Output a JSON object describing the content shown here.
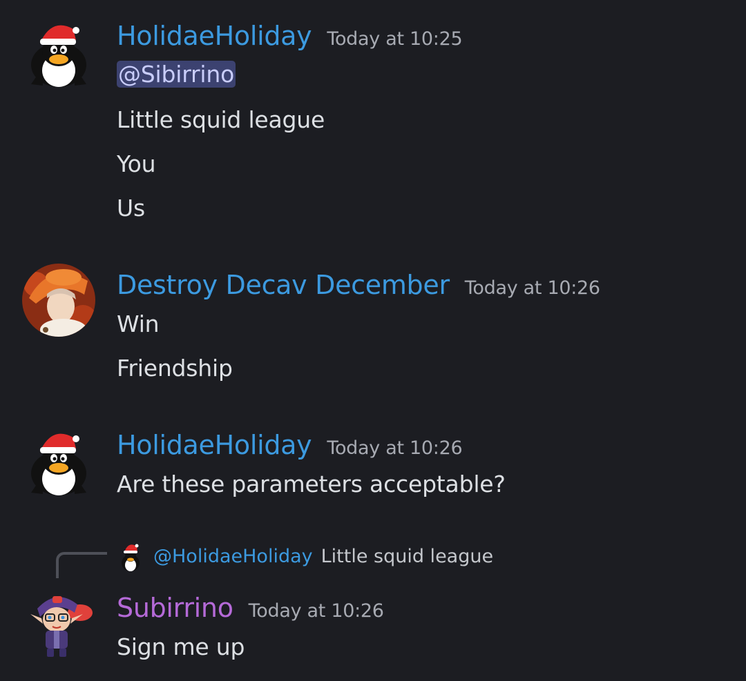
{
  "colors": {
    "background": "#1c1d22",
    "username_blue": "#3c9ae0",
    "username_purple": "#b56ad8",
    "timestamp": "#a7aab2",
    "mention_bg": "#3c4270"
  },
  "messages": [
    {
      "author": "HolidaeHoliday",
      "timestamp": "Today at 10:25",
      "avatar_icon": "santa-penguin-avatar",
      "mention": "@Sibirrino",
      "lines": [
        "Little squid league",
        "You",
        "Us"
      ]
    },
    {
      "author": "Destroy Decav December",
      "timestamp": "Today at 10:26",
      "avatar_icon": "anime-character-avatar",
      "lines": [
        "Win",
        "Friendship"
      ]
    },
    {
      "author": "HolidaeHoliday",
      "timestamp": "Today at 10:26",
      "avatar_icon": "santa-penguin-avatar",
      "lines": [
        "Are these parameters acceptable?"
      ]
    },
    {
      "author": "Subirrino",
      "timestamp": "Today at 10:26",
      "avatar_icon": "squid-kid-avatar",
      "reply": {
        "author": "@HolidaeHoliday",
        "text": "Little squid league",
        "avatar_icon": "santa-penguin-avatar"
      },
      "lines": [
        "Sign me up"
      ]
    }
  ]
}
